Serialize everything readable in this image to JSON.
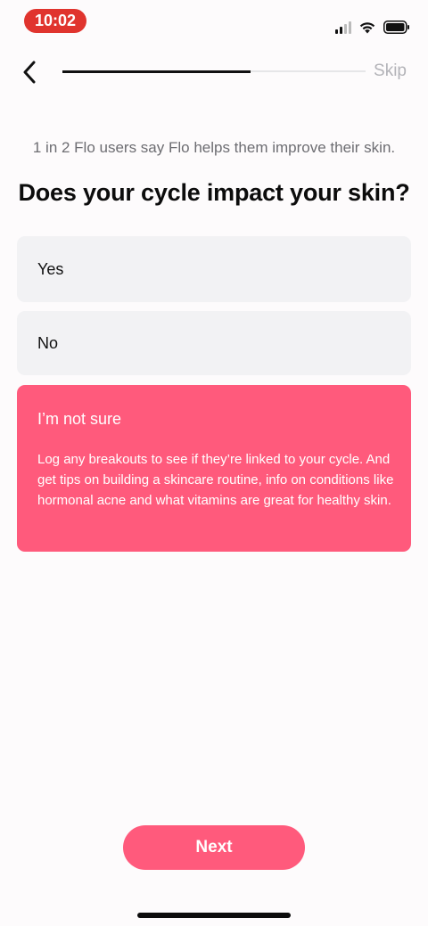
{
  "status_bar": {
    "time": "10:02",
    "signal_icon": "cellular-signal-icon",
    "wifi_icon": "wifi-icon",
    "battery_icon": "battery-icon"
  },
  "nav": {
    "back_icon": "chevron-left-icon",
    "skip_label": "Skip",
    "progress_fraction": 0.62
  },
  "subtitle": "1 in 2 Flo users say Flo helps them improve their skin.",
  "question": "Does your cycle impact your skin?",
  "options": [
    {
      "label": "Yes",
      "selected": false
    },
    {
      "label": "No",
      "selected": false
    },
    {
      "label": "I’m not sure",
      "selected": true,
      "description": "Log any breakouts to see if they’re linked to your cycle. And get tips on building a skincare routine, info on conditions like hormonal acne and what vitamins are great for healthy skin."
    }
  ],
  "next_label": "Next",
  "colors": {
    "accent": "#ff5a7c",
    "time_pill": "#e0342e",
    "option_bg": "#f2f2f4"
  }
}
